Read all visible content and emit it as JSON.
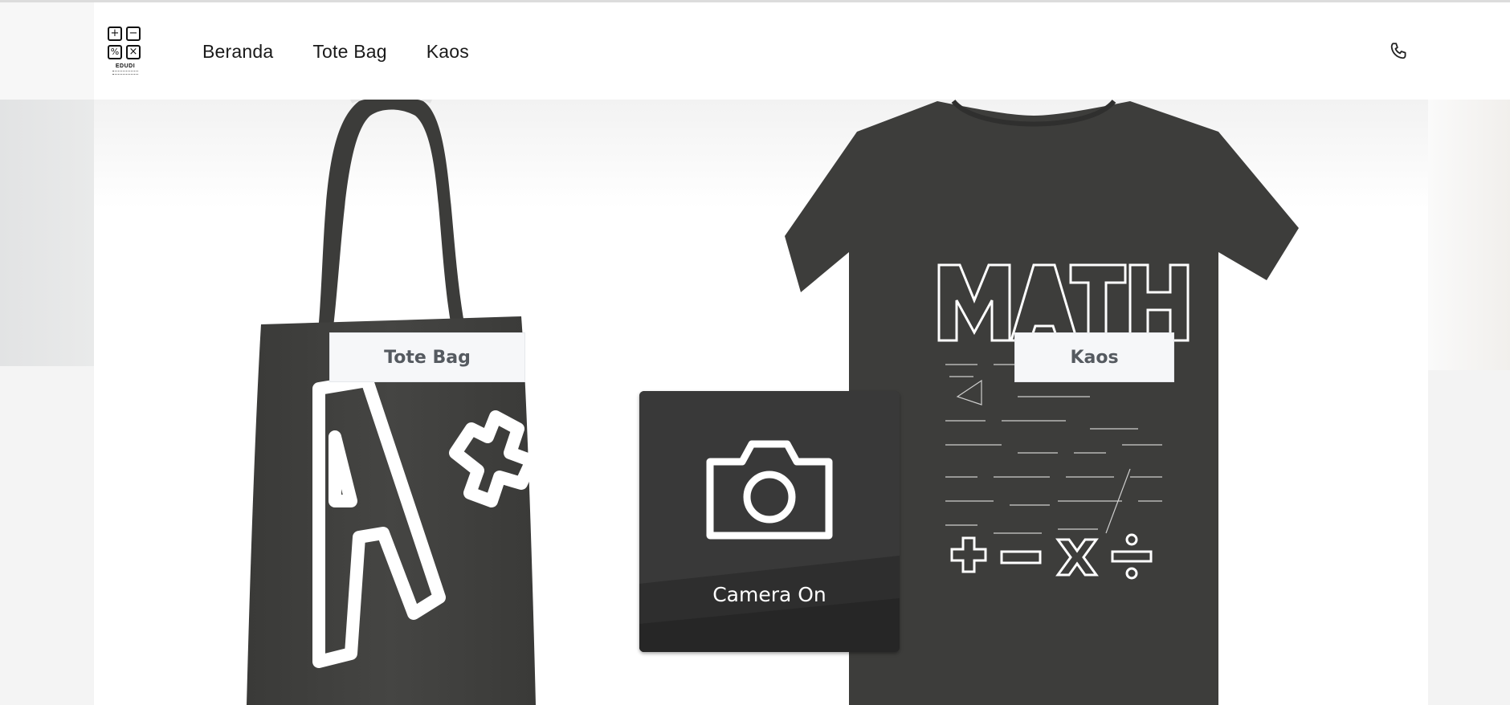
{
  "header": {
    "logo": {
      "brand": "EDUDI",
      "symbols": [
        "+",
        "−",
        "%",
        "×"
      ]
    },
    "nav": [
      {
        "label": "Beranda"
      },
      {
        "label": "Tote Bag"
      },
      {
        "label": "Kaos"
      }
    ],
    "phone_icon": "phone-icon"
  },
  "hero": {
    "products": [
      {
        "label": "Tote Bag",
        "print": "A+"
      },
      {
        "label": "Kaos",
        "print": "MATH"
      }
    ],
    "camera": {
      "icon": "camera-icon",
      "label": "Camera On"
    }
  },
  "colors": {
    "garment": "#3e3e3c",
    "nav_text": "#1a1a1a",
    "label_bg": "#f6f7f9",
    "label_text": "#555a60",
    "camera_bg": "#373737"
  }
}
